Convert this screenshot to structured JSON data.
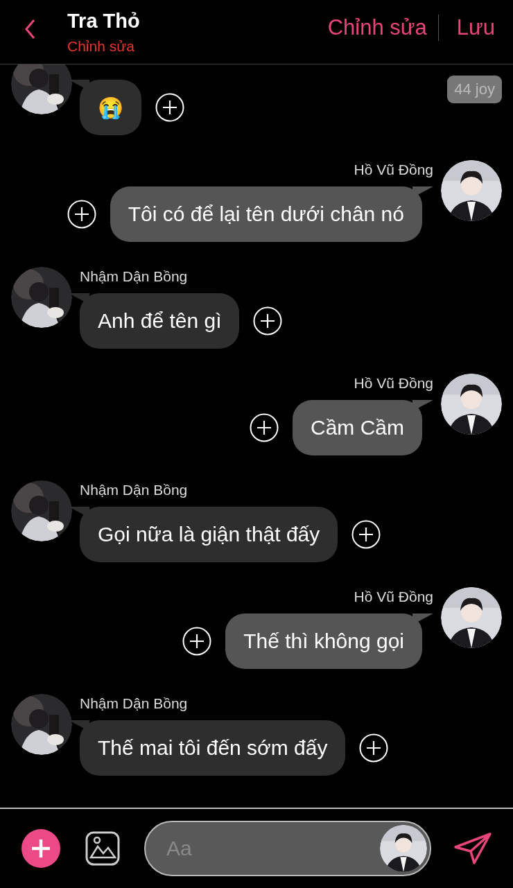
{
  "header": {
    "title": "Tra Thỏ",
    "subtitle": "Chỉnh sửa",
    "actions": [
      "Chỉnh sửa",
      "Lưu"
    ]
  },
  "badge": "44 joy",
  "messages": [
    {
      "kind": "incoming",
      "text": "😭"
    },
    {
      "kind": "outgoing",
      "name": "Hồ Vũ Đồng",
      "text": "Tôi có để lại tên dưới chân nó"
    },
    {
      "kind": "incoming",
      "name": "Nhậm Dận Bồng",
      "text": "Anh để tên gì"
    },
    {
      "kind": "outgoing",
      "name": "Hồ Vũ Đồng",
      "text": "Cầm Cầm"
    },
    {
      "kind": "incoming",
      "name": "Nhậm Dận Bồng",
      "text": "Gọi nữa là giận thật đấy"
    },
    {
      "kind": "outgoing",
      "name": "Hồ Vũ Đồng",
      "text": "Thế thì không gọi"
    },
    {
      "kind": "incoming",
      "name": "Nhậm Dận Bồng",
      "text": "Thế mai tôi đến sớm đấy"
    }
  ],
  "composer": {
    "placeholder": "Aa"
  }
}
